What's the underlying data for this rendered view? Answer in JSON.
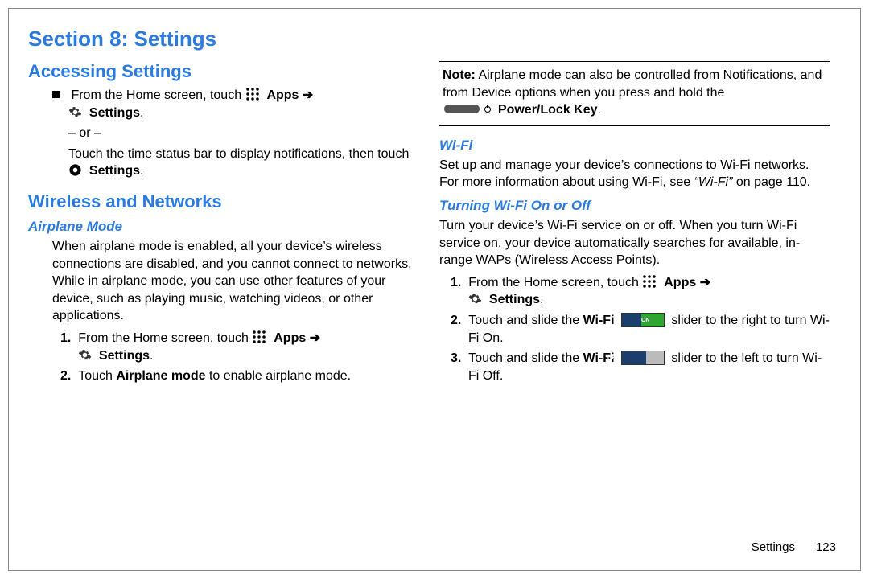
{
  "title": "Section 8: Settings",
  "col1": {
    "h2a": "Accessing Settings",
    "p_from_home1": "From the Home screen, touch ",
    "apps_label": "Apps",
    "arrow": "➔",
    "settings_label": "Settings",
    "or": "– or –",
    "p_statusbar_a": "Touch the time status bar to display notifications, then touch ",
    "h2b": "Wireless and Networks",
    "h3_airplane": "Airplane Mode",
    "p_airplane": "When airplane mode is enabled, all your device’s wireless connections are disabled, and you cannot connect to networks. While in airplane mode, you can use other features of your device, such as playing music, watching videos, or other applications.",
    "step1": "1.",
    "step2": "2.",
    "step2_text_a": "Touch ",
    "step2_text_b": "Airplane mode",
    "step2_text_c": " to enable airplane mode."
  },
  "col2": {
    "note_label": "Note:",
    "note_text_a": " Airplane mode can also be controlled from Notifications, and from Device options when you press and hold the ",
    "powerlock": "Power/Lock Key",
    "h3_wifi": "Wi-Fi",
    "p_wifi_a": "Set up and manage your device’s connections to Wi-Fi networks. For more information about using Wi-Fi, see ",
    "p_wifi_b": "“Wi-Fi”",
    "p_wifi_c": " on page 110.",
    "h3_turn": "Turning Wi-Fi On or Off",
    "p_turn": "Turn your device’s Wi-Fi service on or off. When you turn Wi-Fi service on, your device automatically searches for available, in-range WAPs (Wireless Access Points).",
    "step1": "1.",
    "step2": "2.",
    "step3": "3.",
    "from_home": "From the Home screen, touch ",
    "s2a": "Touch and slide the ",
    "wifi_bold": "Wi-Fi",
    "s2b": " slider to the right to turn Wi-Fi On.",
    "s3b": " slider to the left to turn Wi-Fi Off."
  },
  "footer": {
    "label": "Settings",
    "page": "123"
  }
}
